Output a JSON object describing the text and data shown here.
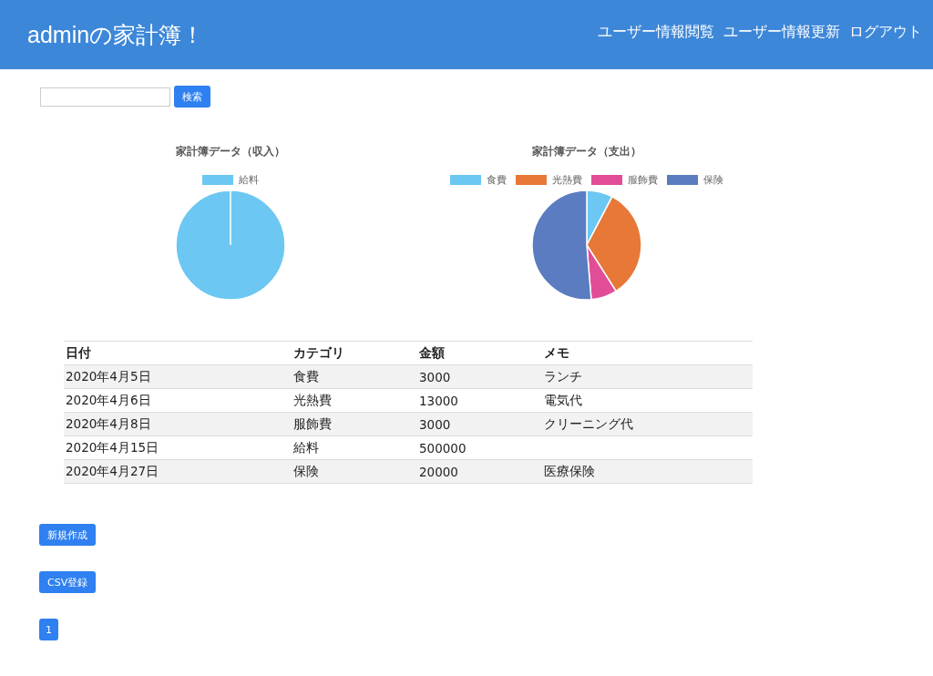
{
  "header": {
    "title": "adminの家計簿！",
    "nav": [
      "ユーザー情報閲覧",
      "ユーザー情報更新",
      "ログアウト"
    ]
  },
  "search": {
    "button": "検索"
  },
  "charts": [
    {
      "chart_data": {
        "type": "pie",
        "title": "家計簿データ（収入）",
        "legend": "top",
        "categories": [
          "給料"
        ],
        "values": [
          100
        ]
      },
      "slices": [
        {
          "color": "#6cc8f2"
        }
      ]
    },
    {
      "chart_data": {
        "type": "pie",
        "title": "家計簿データ（支出）",
        "legend": "top",
        "categories": [
          "食費",
          "光熱費",
          "服飾費",
          "保険"
        ],
        "values": [
          7.7,
          33.3,
          7.7,
          51.3
        ]
      },
      "slices": [
        {
          "color": "#6cc8f2"
        },
        {
          "color": "#e77837"
        },
        {
          "color": "#e24d97"
        },
        {
          "color": "#5b7cc0"
        }
      ]
    }
  ],
  "table": {
    "columns": [
      "日付",
      "カテゴリ",
      "金額",
      "メモ"
    ],
    "rows": [
      {
        "date": "2020年4月5日",
        "category": "食費",
        "amount": "3000",
        "memo": "ランチ"
      },
      {
        "date": "2020年4月6日",
        "category": "光熱費",
        "amount": "13000",
        "memo": "電気代"
      },
      {
        "date": "2020年4月8日",
        "category": "服飾費",
        "amount": "3000",
        "memo": "クリーニング代"
      },
      {
        "date": "2020年4月15日",
        "category": "給料",
        "amount": "500000"
      },
      {
        "date": "2020年4月27日",
        "category": "保険",
        "amount": "20000",
        "memo": "医療保険"
      }
    ]
  },
  "buttons": [
    "新規作成",
    "CSV登録"
  ],
  "pagination": [
    "1"
  ]
}
